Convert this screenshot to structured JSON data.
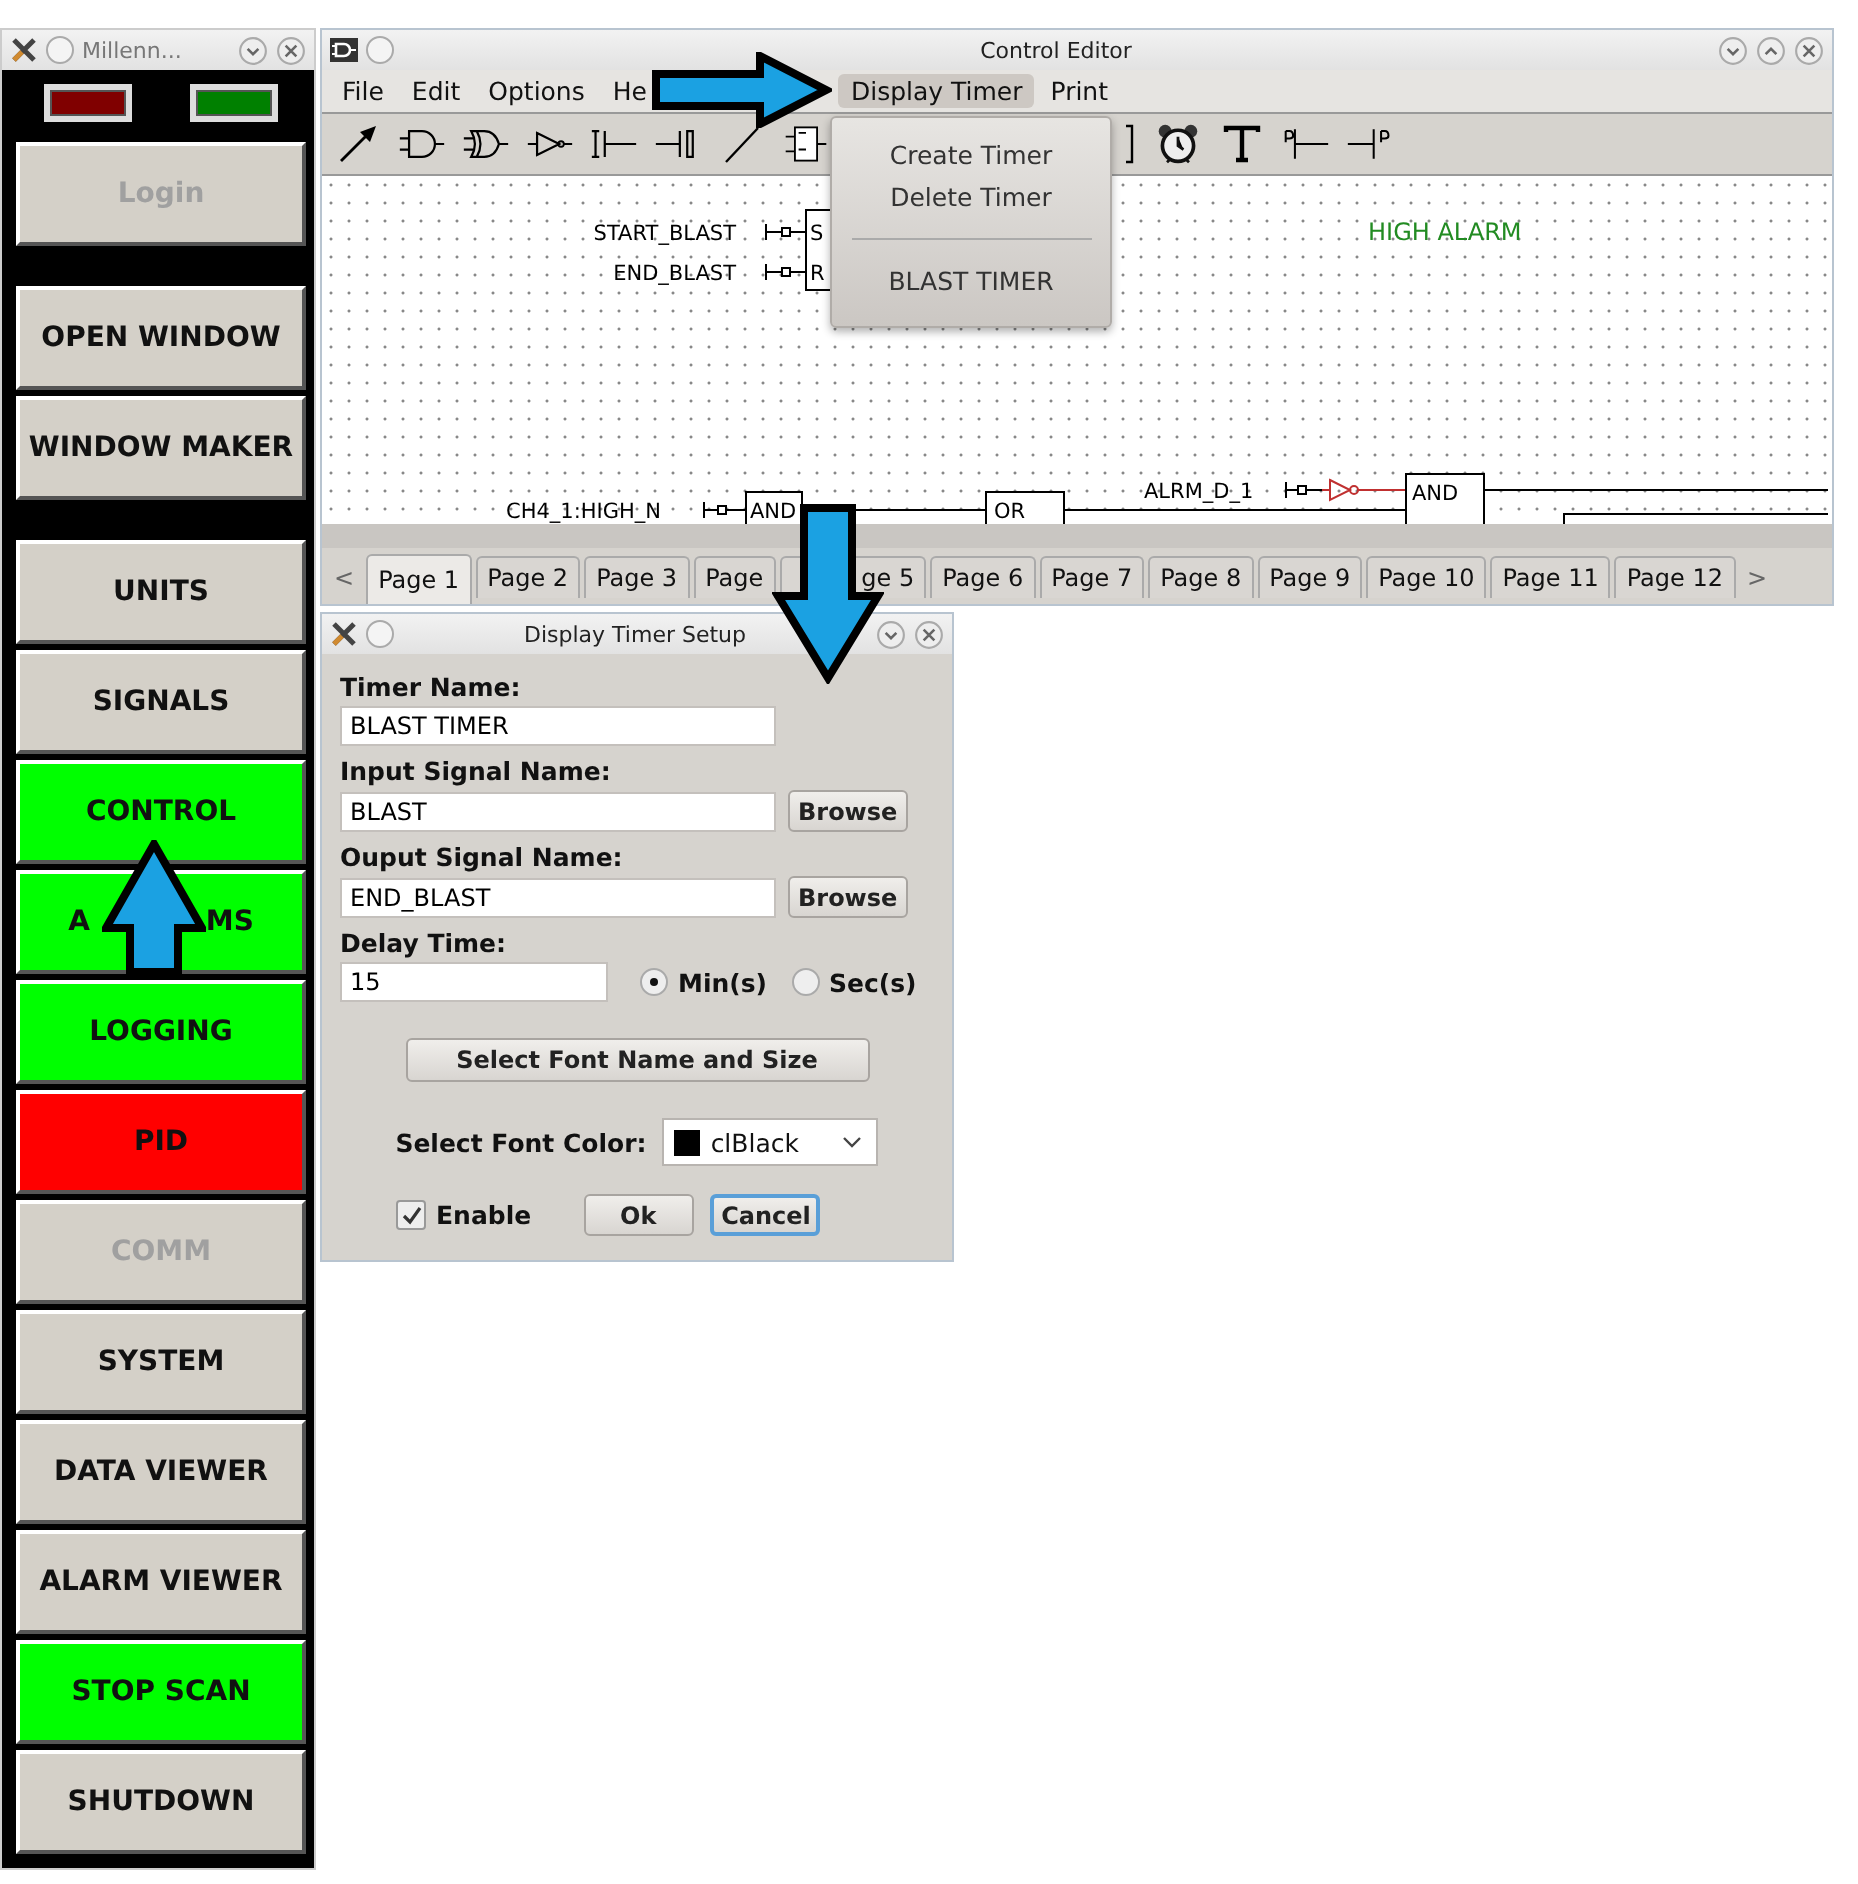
{
  "launcher": {
    "title": "Millenn...",
    "indicators": [
      {
        "color": "#800000"
      },
      {
        "color": "#008000"
      }
    ],
    "button_groups": [
      [
        {
          "label_parts": [
            "Login"
          ],
          "color": "#d4d0c8",
          "disabled": true
        }
      ],
      [
        {
          "label_parts": [
            "OPEN WINDOW"
          ],
          "color": "#d4d0c8",
          "disabled": false
        },
        {
          "label_parts": [
            "WINDOW MAKER"
          ],
          "color": "#d4d0c8",
          "disabled": false
        }
      ],
      [
        {
          "label_parts": [
            "UNITS"
          ],
          "color": "#d4d0c8",
          "disabled": false
        },
        {
          "label_parts": [
            "SIGNALS"
          ],
          "color": "#d4d0c8",
          "disabled": false
        },
        {
          "label_parts": [
            "CONTROL"
          ],
          "color": "#00ff00",
          "disabled": false
        },
        {
          "label_parts": [
            "A",
            "MS"
          ],
          "color": "#00ff00",
          "disabled": false
        },
        {
          "label_parts": [
            "LOGGING"
          ],
          "color": "#00ff00",
          "disabled": false
        },
        {
          "label_parts": [
            "PID"
          ],
          "color": "#ff0000",
          "disabled": false
        },
        {
          "label_parts": [
            "COMM"
          ],
          "color": "#d4d0c8",
          "disabled": true
        },
        {
          "label_parts": [
            "SYSTEM"
          ],
          "color": "#d4d0c8",
          "disabled": false
        },
        {
          "label_parts": [
            "DATA VIEWER"
          ],
          "color": "#d4d0c8",
          "disabled": false
        },
        {
          "label_parts": [
            "ALARM VIEWER"
          ],
          "color": "#d4d0c8",
          "disabled": false
        },
        {
          "label_parts": [
            "STOP SCAN"
          ],
          "color": "#00ff00",
          "disabled": false
        },
        {
          "label_parts": [
            "SHUTDOWN"
          ],
          "color": "#d4d0c8",
          "disabled": false
        }
      ]
    ]
  },
  "editor": {
    "title": "Control Editor",
    "menu": [
      {
        "label": "File",
        "selected": false
      },
      {
        "label": "Edit",
        "selected": false
      },
      {
        "label": "Options",
        "selected": false
      },
      {
        "label": "He",
        "selected": false
      },
      {
        "label": "Display Timer",
        "selected": true
      },
      {
        "label": "Print",
        "selected": false
      }
    ],
    "dropdown": [
      {
        "kind": "item",
        "label": "Create Timer"
      },
      {
        "kind": "item",
        "label": "Delete Timer"
      },
      {
        "kind": "separator"
      },
      {
        "kind": "item",
        "label": "BLAST TIMER"
      }
    ],
    "diagram": {
      "timer_inputs": [
        {
          "signal": "START_BLAST",
          "pin": "S"
        },
        {
          "signal": "END_BLAST",
          "pin": "R"
        }
      ],
      "text_label": "HIGH ALARM",
      "rung": {
        "input_1": "CH4_1:HIGH_N",
        "gate_1": "AND",
        "gate_2": "OR",
        "input_2": "ALRM_D_1",
        "gate_3": "AND"
      }
    },
    "tab_scroll": [
      "<",
      ">"
    ],
    "tabs": [
      {
        "label": "Page 1",
        "selected": true
      },
      {
        "label": "Page 2",
        "selected": false
      },
      {
        "label": "Page 3",
        "selected": false
      },
      {
        "label": "Page",
        "selected": false
      },
      {
        "label": "ge 5",
        "selected": false
      },
      {
        "label": "Page 6",
        "selected": false
      },
      {
        "label": "Page 7",
        "selected": false
      },
      {
        "label": "Page 8",
        "selected": false
      },
      {
        "label": "Page 9",
        "selected": false
      },
      {
        "label": "Page 10",
        "selected": false
      },
      {
        "label": "Page 11",
        "selected": false
      },
      {
        "label": "Page 12",
        "selected": false
      }
    ]
  },
  "dialog": {
    "title": "Display Timer Setup",
    "fields": [
      {
        "label": "Timer Name:",
        "value": "BLAST TIMER"
      },
      {
        "label": "Input Signal Name:",
        "value": "BLAST",
        "button": "Browse"
      },
      {
        "label": "Ouput Signal Name:",
        "value": "END_BLAST",
        "button": "Browse"
      }
    ],
    "delay": {
      "label": "Delay Time:",
      "value": "15",
      "units": [
        {
          "label": "Min(s)",
          "selected": true
        },
        {
          "label": "Sec(s)",
          "selected": false
        }
      ]
    },
    "font_button": "Select Font Name and Size",
    "font_color": {
      "label": "Select Font Color:",
      "value": "clBlack",
      "color": "#000000"
    },
    "enable": {
      "label": "Enable",
      "checked": true
    },
    "actions": [
      {
        "label": "Ok",
        "focused": false
      },
      {
        "label": "Cancel",
        "focused": true
      }
    ]
  },
  "pointer_arrows": [
    {
      "kind": "right"
    },
    {
      "kind": "down"
    },
    {
      "kind": "up"
    }
  ]
}
